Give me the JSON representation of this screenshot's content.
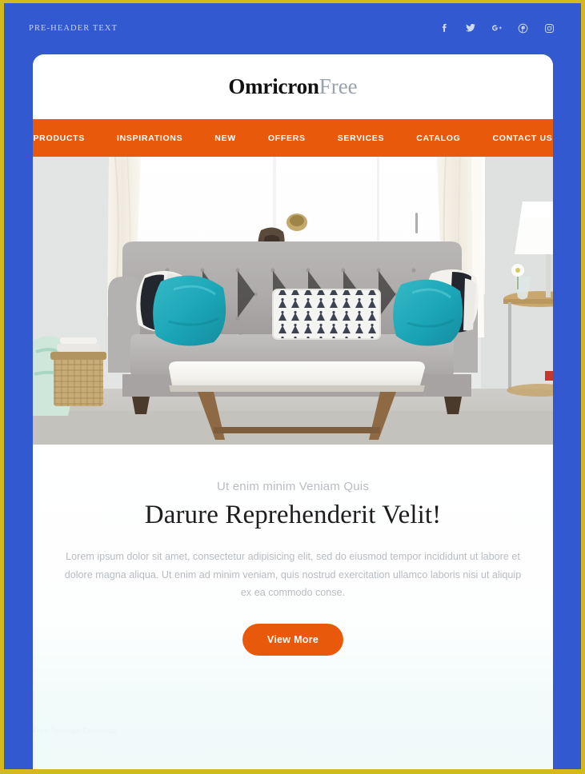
{
  "frame": {
    "border_color": "#d4b81f",
    "background_color": "#3259d0"
  },
  "preheader": {
    "text": "PRE-HEADER TEXT",
    "social": [
      {
        "name": "facebook-icon",
        "label": "Facebook"
      },
      {
        "name": "twitter-icon",
        "label": "Twitter"
      },
      {
        "name": "google-plus-icon",
        "label": "Google Plus"
      },
      {
        "name": "pinterest-icon",
        "label": "Pinterest"
      },
      {
        "name": "instagram-icon",
        "label": "Instagram"
      }
    ]
  },
  "logo": {
    "primary": "Omricron",
    "secondary": "Free",
    "primary_color": "#111111",
    "secondary_color": "#9aa2ad"
  },
  "nav": {
    "background_color": "#e8590c",
    "items": [
      {
        "label": "PRODUCTS"
      },
      {
        "label": "INSPIRATIONS"
      },
      {
        "label": "NEW"
      },
      {
        "label": "OFFERS"
      },
      {
        "label": "SERVICES"
      },
      {
        "label": "CATALOG"
      },
      {
        "label": "CONTACT US"
      }
    ]
  },
  "hero": {
    "alt": "Living room with gray tufted sofa, teal cushions and white coffee table"
  },
  "content": {
    "eyebrow": "Ut enim minim Veniam Quis",
    "headline": "Darure Reprehenderit Velit!",
    "body": "Lorem ipsum dolor sit amet, consectetur adipisicing elit, sed do eiusmod tempor incididunt ut labore et dolore magna aliqua. Ut enim ad minim veniam, quis nostrud exercitation ullamco laboris nisi ut aliquip ex ea commodo conse.",
    "cta_label": "View More",
    "cta_color": "#e8590c",
    "watermark": "Free Template Download"
  }
}
